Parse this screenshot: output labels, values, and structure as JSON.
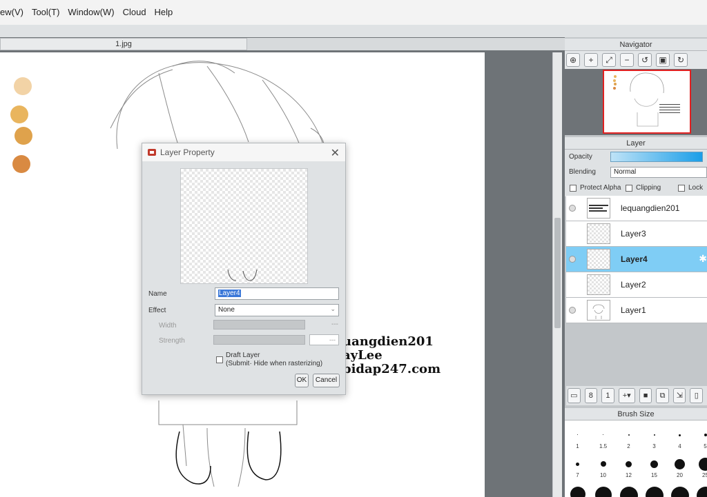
{
  "menu": [
    "ew(V)",
    "Tool(T)",
    "Window(W)",
    "Cloud",
    "Help"
  ],
  "document_tab": "1.jpg",
  "canvas_text": [
    "uangdien201",
    "ayLee",
    "bidap247.com"
  ],
  "dialog": {
    "title": "Layer Property",
    "name_label": "Name",
    "name_value": "Layer4",
    "effect_label": "Effect",
    "effect_value": "None",
    "width_label": "Width",
    "width_value": "---",
    "strength_label": "Strength",
    "strength_value": "---",
    "draft_label": "Draft Layer",
    "draft_sub": "(Submit· Hide when rasterizing)",
    "ok": "OK",
    "cancel": "Cancel"
  },
  "navigator": {
    "title": "Navigator"
  },
  "layer_panel": {
    "title": "Layer",
    "opacity_label": "Opacity",
    "opacity_fraction": 1.0,
    "blending_label": "Blending",
    "blending_value": "Normal",
    "protect_alpha": "Protect Alpha",
    "clipping": "Clipping",
    "lock": "Lock",
    "layers": [
      {
        "name": "lequangdien201",
        "visible": true,
        "selected": false
      },
      {
        "name": "Layer3",
        "visible": false,
        "selected": false
      },
      {
        "name": "Layer4",
        "visible": true,
        "selected": true
      },
      {
        "name": "Layer2",
        "visible": false,
        "selected": false
      },
      {
        "name": "Layer1",
        "visible": true,
        "selected": false
      }
    ]
  },
  "brush_size": {
    "title": "Brush Size",
    "row1": [
      "1",
      "1.5",
      "2",
      "3",
      "4",
      "5"
    ],
    "row2": [
      "7",
      "10",
      "12",
      "15",
      "20",
      "25"
    ]
  },
  "colors": {
    "accent": "#7fcdf5",
    "selection": "#3b78d8"
  }
}
